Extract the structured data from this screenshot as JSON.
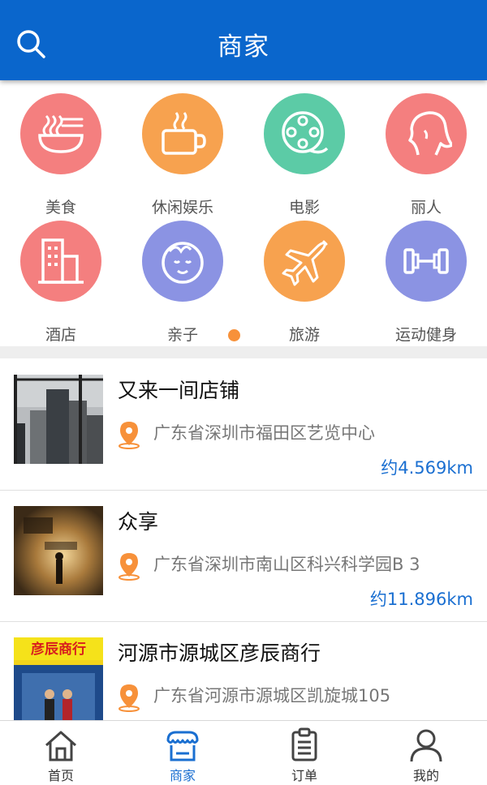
{
  "header": {
    "title": "商家",
    "search_icon": "search-icon"
  },
  "categories": [
    {
      "label": "美食",
      "icon": "noodle-bowl-icon",
      "color": "#f47f7f"
    },
    {
      "label": "休闲娱乐",
      "icon": "coffee-cup-icon",
      "color": "#f7a24f"
    },
    {
      "label": "电影",
      "icon": "film-reel-icon",
      "color": "#5ccba6"
    },
    {
      "label": "丽人",
      "icon": "woman-face-icon",
      "color": "#f47f7f"
    },
    {
      "label": "酒店",
      "icon": "building-icon",
      "color": "#f47f7f"
    },
    {
      "label": "亲子",
      "icon": "baby-face-icon",
      "color": "#8b93e3"
    },
    {
      "label": "旅游",
      "icon": "airplane-icon",
      "color": "#f7a24f"
    },
    {
      "label": "运动健身",
      "icon": "dumbbell-icon",
      "color": "#8b93e3"
    }
  ],
  "pager": {
    "active_color": "#f7913a"
  },
  "shops": [
    {
      "name": "又来一间店铺",
      "address": "广东省深圳市福田区艺览中心",
      "distance": "约4.569km",
      "thumb": "city-buildings-photo"
    },
    {
      "name": "众享",
      "address": "广东省深圳市南山区科兴科学园B 3",
      "distance": "约11.896km",
      "thumb": "movie-poster-photo"
    },
    {
      "name": "河源市源城区彦辰商行",
      "address": "广东省河源市源城区凯旋城105",
      "distance": "",
      "thumb": "shop-front-photo",
      "thumb_sign": "彦辰商行"
    }
  ],
  "tabs": [
    {
      "label": "首页",
      "icon": "home-icon",
      "active": false
    },
    {
      "label": "商家",
      "icon": "store-icon",
      "active": true
    },
    {
      "label": "订单",
      "icon": "clipboard-icon",
      "active": false
    },
    {
      "label": "我的",
      "icon": "person-icon",
      "active": false
    }
  ],
  "colors": {
    "brand": "#0a66cc",
    "accent_text": "#1a6fd1",
    "pin": "#f7913a"
  }
}
